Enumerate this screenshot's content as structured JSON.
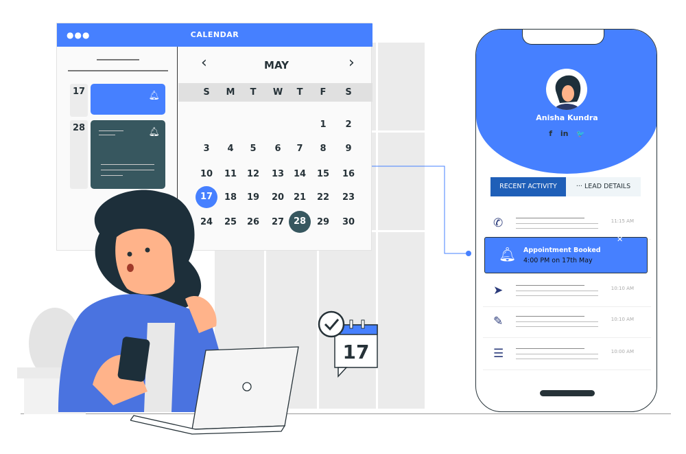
{
  "calendar": {
    "title": "CALENDAR",
    "dots": "●●●",
    "month": "MAY",
    "prev_icon": "chevron-left-icon",
    "next_icon": "chevron-right-icon",
    "weekdays": [
      "S",
      "M",
      "T",
      "W",
      "T",
      "F",
      "S"
    ],
    "weeks": [
      [
        "",
        "",
        "",
        "",
        "",
        "1",
        "2"
      ],
      [
        "3",
        "4",
        "5",
        "6",
        "7",
        "8",
        "9"
      ],
      [
        "10",
        "11",
        "12",
        "13",
        "14",
        "15",
        "16"
      ],
      [
        "17",
        "18",
        "19",
        "20",
        "21",
        "22",
        "23"
      ],
      [
        "24",
        "25",
        "26",
        "27",
        "28",
        "29",
        "30"
      ]
    ],
    "selected_day": "17",
    "highlighted_day": "28",
    "events": [
      {
        "day": "17",
        "color": "#4680ff",
        "icon": "bell-icon"
      },
      {
        "day": "28",
        "color": "#37575f",
        "icon": "bell-icon"
      }
    ]
  },
  "badge_day": "17",
  "phone": {
    "user_name": "Anisha Kundra",
    "social": [
      "f",
      "in",
      "🐦"
    ],
    "tabs": [
      {
        "label": "RECENT ACTIVITY",
        "active": true
      },
      {
        "label": "··· LEAD DETAILS",
        "active": false
      }
    ],
    "activities": [
      {
        "icon": "phone-icon",
        "time": "11:15 AM"
      },
      {
        "icon": "send-icon",
        "time": "10:10 AM"
      },
      {
        "icon": "edit-icon",
        "time": "10:10 AM"
      },
      {
        "icon": "document-icon",
        "time": "10:00 AM"
      }
    ],
    "notification": {
      "title": "Appointment Booked",
      "subtitle": "4:00 PM on 17th May",
      "icon": "bell-icon",
      "close": "✕"
    }
  },
  "colors": {
    "accent": "#4680ff",
    "dark": "#263238",
    "slate": "#37575f",
    "tab_active": "#1f5fb8"
  }
}
